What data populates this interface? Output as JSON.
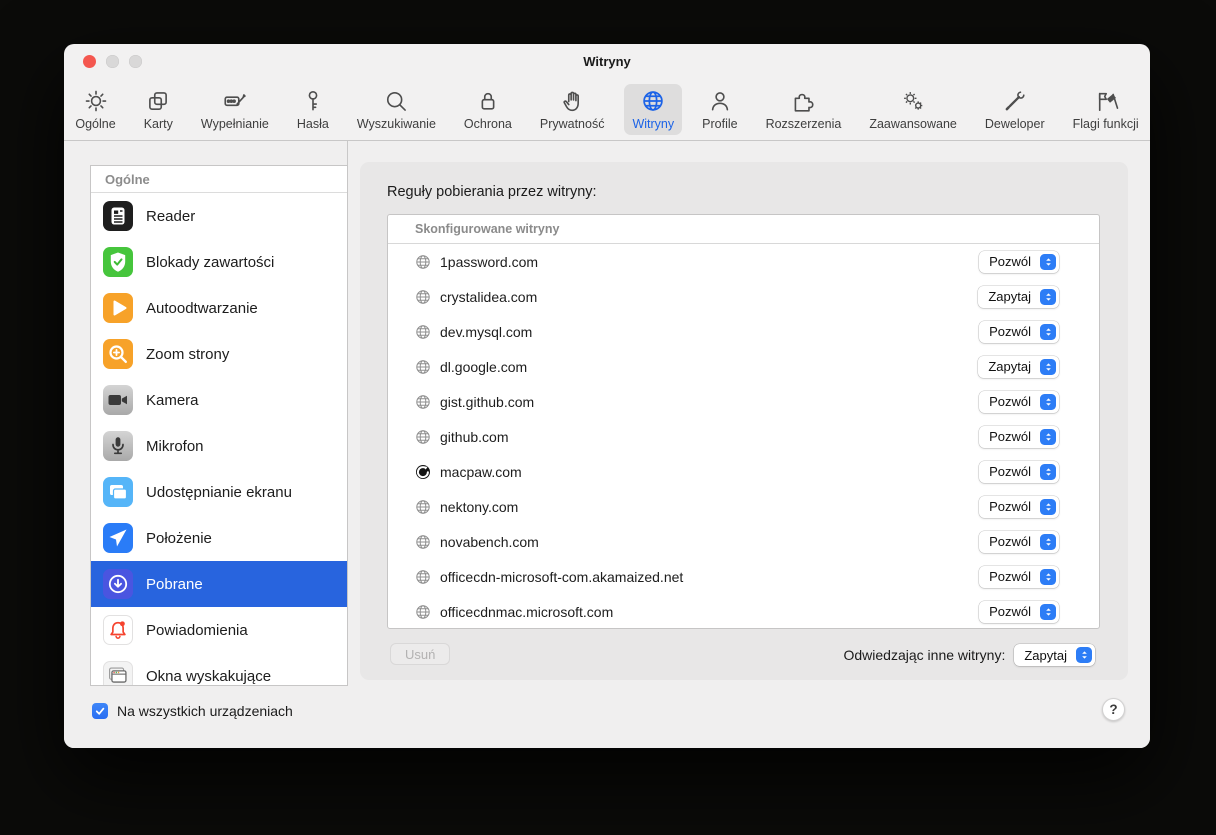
{
  "window": {
    "title": "Witryny"
  },
  "toolbar": {
    "items": [
      {
        "id": "ogolne",
        "label": "Ogólne",
        "icon": "gear"
      },
      {
        "id": "karty",
        "label": "Karty",
        "icon": "tabs"
      },
      {
        "id": "wypelnianie",
        "label": "Wypełnianie",
        "icon": "autofill"
      },
      {
        "id": "hasla",
        "label": "Hasła",
        "icon": "key"
      },
      {
        "id": "wyszukiwanie",
        "label": "Wyszukiwanie",
        "icon": "search"
      },
      {
        "id": "ochrona",
        "label": "Ochrona",
        "icon": "lock"
      },
      {
        "id": "prywatnosc",
        "label": "Prywatność",
        "icon": "hand"
      },
      {
        "id": "witryny",
        "label": "Witryny",
        "icon": "globe",
        "selected": true
      },
      {
        "id": "profile",
        "label": "Profile",
        "icon": "person"
      },
      {
        "id": "rozszerzenia",
        "label": "Rozszerzenia",
        "icon": "puzzle"
      },
      {
        "id": "zaawansowane",
        "label": "Zaawansowane",
        "icon": "gears"
      },
      {
        "id": "deweloper",
        "label": "Deweloper",
        "icon": "tools"
      },
      {
        "id": "flagi-funkcji",
        "label": "Flagi funkcji",
        "icon": "flags"
      }
    ]
  },
  "sidebar": {
    "header": "Ogólne",
    "items": [
      {
        "id": "reader",
        "label": "Reader",
        "icon": "reader",
        "color": "#1E1E1E"
      },
      {
        "id": "blokady-zawartosci",
        "label": "Blokady zawartości",
        "icon": "shield-check",
        "color": "#46C53C"
      },
      {
        "id": "autoodtwarzanie",
        "label": "Autoodtwarzanie",
        "icon": "play",
        "color": "#F7A229"
      },
      {
        "id": "zoom-strony",
        "label": "Zoom strony",
        "icon": "zoom-plus",
        "color": "#F7A229"
      },
      {
        "id": "kamera",
        "label": "Kamera",
        "icon": "camera",
        "color": "linear-gradient(#D4D4D4,#A9A9A9)"
      },
      {
        "id": "mikrofon",
        "label": "Mikrofon",
        "icon": "mic",
        "color": "linear-gradient(#D4D4D4,#A9A9A9)"
      },
      {
        "id": "udostepnianie-ekranu",
        "label": "Udostępnianie ekranu",
        "icon": "screens",
        "color": "#55B5F8"
      },
      {
        "id": "polozenie",
        "label": "Położenie",
        "icon": "location-arrow",
        "color": "#2A7CF7"
      },
      {
        "id": "pobrane",
        "label": "Pobrane",
        "icon": "download-circle",
        "color": "#4A55E0",
        "selected": true
      },
      {
        "id": "powiadomienia",
        "label": "Powiadomienia",
        "icon": "bell",
        "color": "#FFFFFF",
        "border": true
      },
      {
        "id": "okna-wyskakujace",
        "label": "Okna wyskakujące",
        "icon": "popup-window",
        "color": "#F3F3F3",
        "border": true
      }
    ]
  },
  "main": {
    "title": "Reguły pobierania przez witryny:",
    "table": {
      "header": "Skonfigurowane witryny",
      "rows": [
        {
          "site": "1password.com",
          "value": "Pozwól",
          "icon": "globe-favicon"
        },
        {
          "site": "crystalidea.com",
          "value": "Zapytaj",
          "icon": "globe-favicon"
        },
        {
          "site": "dev.mysql.com",
          "value": "Pozwól",
          "icon": "globe-favicon"
        },
        {
          "site": "dl.google.com",
          "value": "Zapytaj",
          "icon": "globe-favicon"
        },
        {
          "site": "gist.github.com",
          "value": "Pozwól",
          "icon": "globe-favicon"
        },
        {
          "site": "github.com",
          "value": "Pozwól",
          "icon": "globe-favicon"
        },
        {
          "site": "macpaw.com",
          "value": "Pozwól",
          "icon": "macpaw-favicon"
        },
        {
          "site": "nektony.com",
          "value": "Pozwól",
          "icon": "globe-favicon"
        },
        {
          "site": "novabench.com",
          "value": "Pozwól",
          "icon": "globe-favicon"
        },
        {
          "site": "officecdn-microsoft-com.akamaized.net",
          "value": "Pozwól",
          "icon": "globe-favicon"
        },
        {
          "site": "officecdnmac.microsoft.com",
          "value": "Pozwól",
          "icon": "globe-favicon"
        }
      ]
    },
    "remove_button": "Usuń",
    "other_sites_label": "Odwiedzając inne witryny:",
    "other_sites_value": "Zapytaj"
  },
  "footer": {
    "checkbox_label": "Na wszystkich urządzeniach",
    "checkbox_checked": true,
    "help_label": "?"
  },
  "colors": {
    "tab_selected": "#1C63E7",
    "sidebar_selected_row": "#2864DE",
    "control_accent": "#2D7DF6",
    "traffic_red": "#F4574F"
  }
}
